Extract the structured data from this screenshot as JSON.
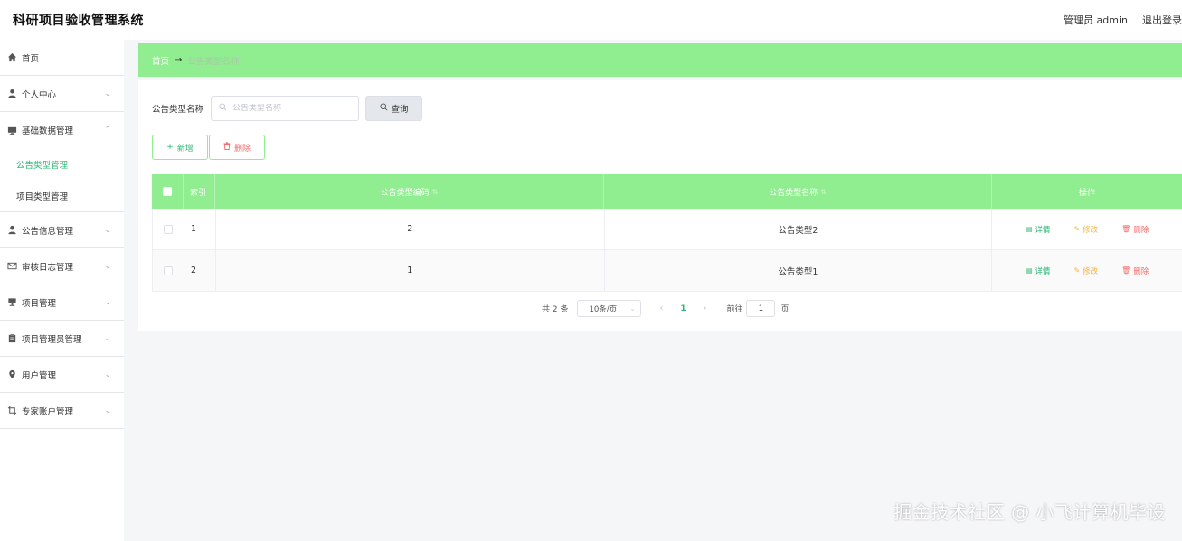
{
  "header": {
    "app_title": "科研项目验收管理系统",
    "user_label": "管理员 admin",
    "logout_label": "退出登录"
  },
  "sidebar": {
    "items": [
      {
        "label": "首页",
        "icon": "home-icon"
      },
      {
        "label": "个人中心",
        "icon": "user-icon"
      },
      {
        "label": "基础数据管理",
        "icon": "monitor-icon"
      },
      {
        "label": "公告信息管理",
        "icon": "user-icon"
      },
      {
        "label": "审核日志管理",
        "icon": "mail-icon"
      },
      {
        "label": "项目管理",
        "icon": "trophy-icon"
      },
      {
        "label": "项目管理员管理",
        "icon": "clipboard-icon"
      },
      {
        "label": "用户管理",
        "icon": "location-icon"
      },
      {
        "label": "专家账户管理",
        "icon": "crop-icon"
      }
    ],
    "submenu": [
      {
        "label": "公告类型管理",
        "active": true
      },
      {
        "label": "项目类型管理",
        "active": false
      }
    ]
  },
  "breadcrumb": {
    "home": "首页",
    "arrow": "→",
    "current": "公告类型名称"
  },
  "search": {
    "label": "公告类型名称",
    "placeholder": "公告类型名称",
    "value": "",
    "query_label": "查询"
  },
  "actions": {
    "add_label": "新增",
    "delete_label": "删除"
  },
  "table": {
    "columns": [
      "索引",
      "公告类型编码",
      "公告类型名称",
      "操作"
    ],
    "rows": [
      {
        "index": "1",
        "code": "2",
        "name": "公告类型2"
      },
      {
        "index": "2",
        "code": "1",
        "name": "公告类型1"
      }
    ],
    "op_labels": {
      "detail": "详情",
      "edit": "修改",
      "delete": "删除"
    }
  },
  "pagination": {
    "total": "共 2 条",
    "page_size": "10条/页",
    "current_page": "1",
    "goto_label": "前往",
    "goto_value": "1",
    "goto_unit": "页"
  },
  "watermark": "掘金技术社区 @ 小飞计算机毕设",
  "colors": {
    "accent": "#90ee90",
    "active_text": "#2bb673",
    "danger": "#f56c6c",
    "warning": "#f5b342"
  }
}
